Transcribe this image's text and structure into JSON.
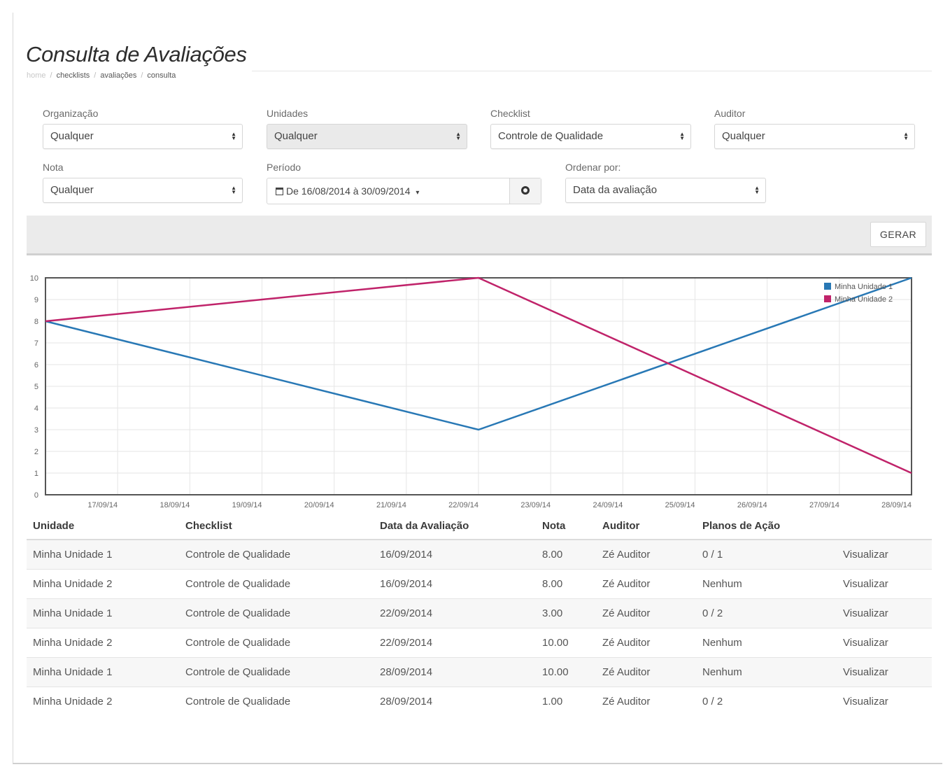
{
  "page": {
    "title": "Consulta de Avaliações",
    "breadcrumb": [
      "home",
      "checklists",
      "avaliações",
      "consulta"
    ]
  },
  "filters": {
    "organizacao": {
      "label": "Organização",
      "value": "Qualquer"
    },
    "unidades": {
      "label": "Unidades",
      "value": "Qualquer"
    },
    "checklist": {
      "label": "Checklist",
      "value": "Controle de Qualidade"
    },
    "auditor": {
      "label": "Auditor",
      "value": "Qualquer"
    },
    "nota": {
      "label": "Nota",
      "value": "Qualquer"
    },
    "periodo": {
      "label": "Período",
      "value": "De 16/08/2014 à 30/09/2014",
      "caret": "▾",
      "calendar_icon": "calendar-icon",
      "button_icon": "gear-icon"
    },
    "ordenar": {
      "label": "Ordenar por:",
      "value": "Data da avaliação"
    }
  },
  "toolbar": {
    "generate_label": "GERAR"
  },
  "chart_data": {
    "type": "line",
    "x": [
      "16/09/14",
      "17/09/14",
      "18/09/14",
      "19/09/14",
      "20/09/14",
      "21/09/14",
      "22/09/14",
      "23/09/14",
      "24/09/14",
      "25/09/14",
      "26/09/14",
      "27/09/14",
      "28/09/14"
    ],
    "x_tick_labels": [
      "17/09/14",
      "18/09/14",
      "19/09/14",
      "20/09/14",
      "21/09/14",
      "22/09/14",
      "23/09/14",
      "24/09/14",
      "25/09/14",
      "26/09/14",
      "27/09/14",
      "28/09/14"
    ],
    "y_ticks": [
      0,
      1,
      2,
      3,
      4,
      5,
      6,
      7,
      8,
      9,
      10
    ],
    "ylim": [
      0,
      10
    ],
    "grid": true,
    "legend_position": "top-right",
    "series": [
      {
        "name": "Minha Unidade 1",
        "color": "#2878b5",
        "points": [
          [
            "16/09/14",
            8
          ],
          [
            "22/09/14",
            3
          ],
          [
            "28/09/14",
            10
          ]
        ]
      },
      {
        "name": "Minha Unidade 2",
        "color": "#c0236a",
        "points": [
          [
            "16/09/14",
            8
          ],
          [
            "22/09/14",
            10
          ],
          [
            "28/09/14",
            1
          ]
        ]
      }
    ]
  },
  "table": {
    "headers": [
      "Unidade",
      "Checklist",
      "Data da Avaliação",
      "Nota",
      "Auditor",
      "Planos de Ação",
      ""
    ],
    "rows": [
      [
        "Minha Unidade 1",
        "Controle de Qualidade",
        "16/09/2014",
        "8.00",
        "Zé Auditor",
        "0 / 1",
        "Visualizar"
      ],
      [
        "Minha Unidade 2",
        "Controle de Qualidade",
        "16/09/2014",
        "8.00",
        "Zé Auditor",
        "Nenhum",
        "Visualizar"
      ],
      [
        "Minha Unidade 1",
        "Controle de Qualidade",
        "22/09/2014",
        "3.00",
        "Zé Auditor",
        "0 / 2",
        "Visualizar"
      ],
      [
        "Minha Unidade 2",
        "Controle de Qualidade",
        "22/09/2014",
        "10.00",
        "Zé Auditor",
        "Nenhum",
        "Visualizar"
      ],
      [
        "Minha Unidade 1",
        "Controle de Qualidade",
        "28/09/2014",
        "10.00",
        "Zé Auditor",
        "Nenhum",
        "Visualizar"
      ],
      [
        "Minha Unidade 2",
        "Controle de Qualidade",
        "28/09/2014",
        "1.00",
        "Zé Auditor",
        "0 / 2",
        "Visualizar"
      ]
    ]
  }
}
